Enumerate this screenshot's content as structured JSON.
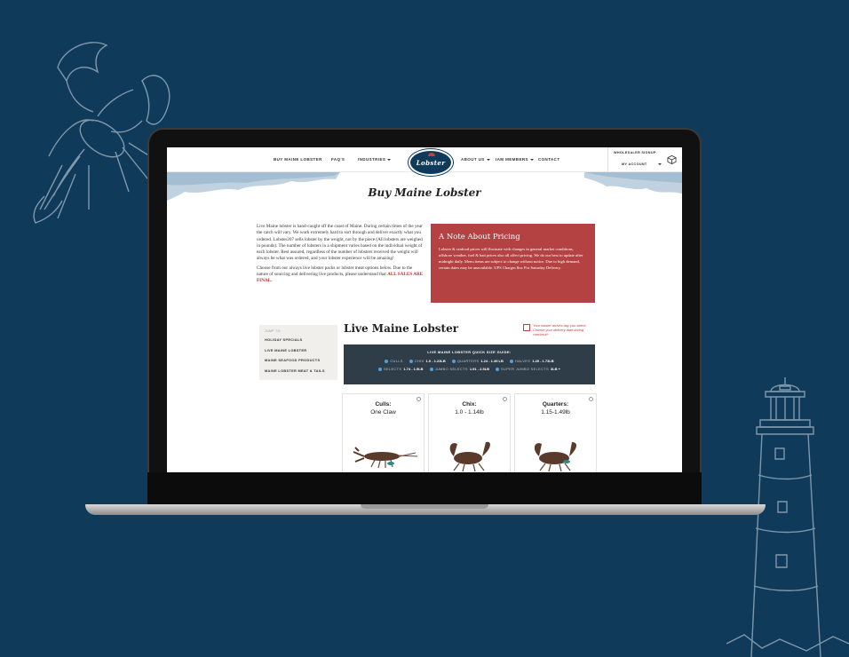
{
  "page": {
    "background_color": "#0f3a5a",
    "decorations": [
      "lobster-sketch",
      "lighthouse-sketch"
    ]
  },
  "nav": {
    "items": [
      {
        "label": "BUY MAINE LOBSTER"
      },
      {
        "label": "FAQ'S"
      },
      {
        "label": "INDUSTRIES"
      },
      {
        "label": "ABOUT US"
      },
      {
        "label": "IAM MEMBERS"
      },
      {
        "label": "CONTACT"
      }
    ],
    "logo_text": "Lobster 207",
    "wholesaler_label": "WHOLESALER SIGNUP",
    "account_label": "MY ACCOUNT"
  },
  "main": {
    "title": "Buy Maine Lobster",
    "intro_p1": "Live Maine lobster is hand-caught off the coast of Maine. During certain times of the year the catch will vary. We work extremely hard to sort through and deliver exactly what you ordered. Lobster207 sells lobster by the weight, not by the piece (All lobsters are weighed in pounds). The number of lobsters in a shipment varies based on the individual weight of each lobster. Rest assured, regardless of the number of lobsters received the weight will always be what was ordered, and your lobster experience will be amazing!",
    "intro_p2": "Choose from our always live lobster packs or lobster meat options below. Due to the nature of sourcing and delivering live products, please understand that",
    "all_sales_final": "ALL SALES ARE FINAL.",
    "note_title": "A Note About Pricing",
    "note_text": "Lobster & seafood prices will fluctuate with changes in general market conditions, offshore weather, fuel & bait prices also all affect pricing. We do our best to update after midnight daily. Menu items are subject to change without notice. Due to high demand, certain dates may be unavailable. UPS Charges $xx For Saturday Delivery.",
    "note_color": "#b44242"
  },
  "sidebar": {
    "jump_label": "JUMP TO:",
    "links": [
      {
        "label": "HOLIDAY SPECIALS"
      },
      {
        "label": "LIVE MAINE LOBSTER"
      },
      {
        "label": "MAINE SEAFOOD PRODUCTS"
      },
      {
        "label": "MAINE LOBSTER MEAT & TAILS"
      }
    ]
  },
  "section": {
    "title": "Live Maine Lobster",
    "calendar_note": "Your lobster arrives day you select. Choose your delivery date during checkout*.",
    "guide_title": "LIVE MAINE LOBSTER QUICK SIZE GUIDE:",
    "guide_items": [
      {
        "name": "CULLS",
        "value": ""
      },
      {
        "name": "CHIX",
        "value": "1.0 - 1.23LB"
      },
      {
        "name": "QUARTERS",
        "value": "1.24 - 1.49 LB"
      },
      {
        "name": "HALVES",
        "value": "1.49 - 1.73LB"
      },
      {
        "name": "SELECTS",
        "value": "1.74 - 1.9LB"
      },
      {
        "name": "JUMBO SELECTS",
        "value": "1.91 - 2.5LB"
      },
      {
        "name": "SUPER JUMBO SELECTS",
        "value": "3LB +"
      }
    ],
    "products": [
      {
        "name": "Culls:",
        "range": "One Claw"
      },
      {
        "name": "Chix:",
        "range": "1.0 - 1.14lb"
      },
      {
        "name": "Quarters:",
        "range": "1.15-1.49lb"
      }
    ]
  }
}
